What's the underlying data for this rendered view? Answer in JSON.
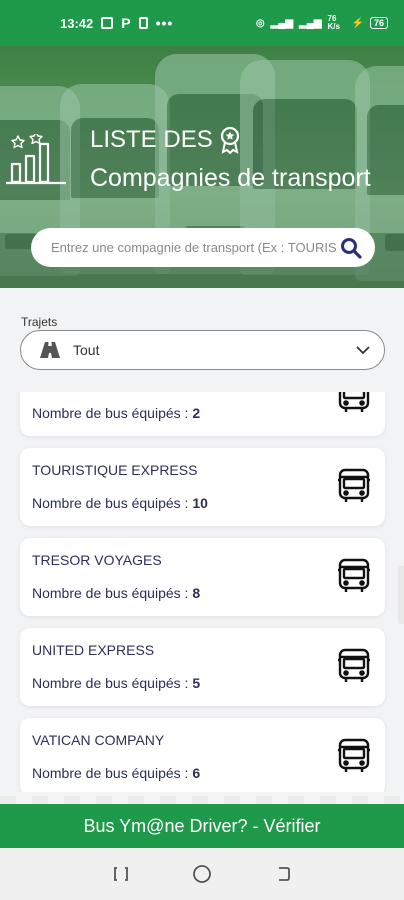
{
  "status_bar": {
    "time": "13:42",
    "network_speed": "76 K/s",
    "battery": "76"
  },
  "hero": {
    "title_line1": "LISTE DES",
    "title_line2": "Compagnies de transport"
  },
  "search": {
    "placeholder": "Entrez une compagnie de transport (Ex : TOURISTIQUE EXPRESS)"
  },
  "filter": {
    "label": "Trajets",
    "selected": "Tout"
  },
  "companies": [
    {
      "name": "",
      "count_label": "Nombre de bus équipés :",
      "count": "2"
    },
    {
      "name": "TOURISTIQUE EXPRESS",
      "count_label": "Nombre de bus équipés :",
      "count": "10"
    },
    {
      "name": "TRESOR VOYAGES",
      "count_label": "Nombre de bus équipés :",
      "count": "8"
    },
    {
      "name": "UNITED EXPRESS",
      "count_label": "Nombre de bus équipés :",
      "count": "5"
    },
    {
      "name": "VATICAN COMPANY",
      "count_label": "Nombre de bus équipés :",
      "count": "6"
    }
  ],
  "bottom_bar": {
    "label": "Bus Ym@ne Driver? - Vérifier"
  },
  "icons": {
    "search": "search-icon",
    "road": "road-icon",
    "bus": "bus-icon",
    "award": "award-icon",
    "chart": "bar-chart-icon"
  },
  "colors": {
    "primary": "#1f9a4a",
    "text_dark": "#2b2f5a",
    "search_icon": "#2b2f7a"
  }
}
